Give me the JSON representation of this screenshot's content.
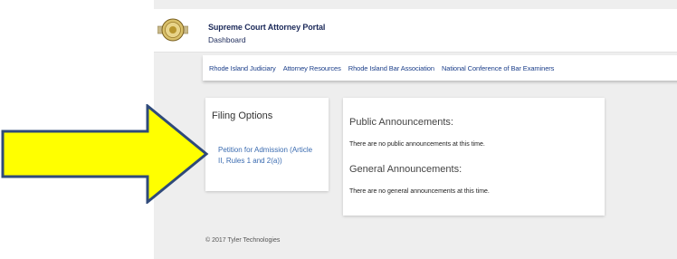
{
  "header": {
    "title": "Supreme Court Attorney Portal",
    "subtitle": "Dashboard"
  },
  "nav": {
    "items": [
      {
        "label": "Rhode Island Judiciary"
      },
      {
        "label": "Attorney Resources"
      },
      {
        "label": "Rhode Island Bar Association"
      },
      {
        "label": "National Conference of Bar Examiners"
      }
    ]
  },
  "filing": {
    "title": "Filing Options",
    "link": "Petition for Admission (Article II, Rules 1 and 2(a))"
  },
  "announcements": {
    "public_title": "Public Announcements:",
    "public_text": "There are no public announcements at this time.",
    "general_title": "General Announcements:",
    "general_text": "There are no general announcements at this time."
  },
  "footer": {
    "copyright": "© 2017 Tyler Technologies"
  },
  "icons": {
    "seal": "court-seal-icon",
    "arrow": "yellow-arrow-icon"
  },
  "colors": {
    "arrow_fill": "#ffff00",
    "arrow_stroke": "#2f4a7a",
    "link": "#3a6bb0",
    "title": "#1c2a5a"
  }
}
